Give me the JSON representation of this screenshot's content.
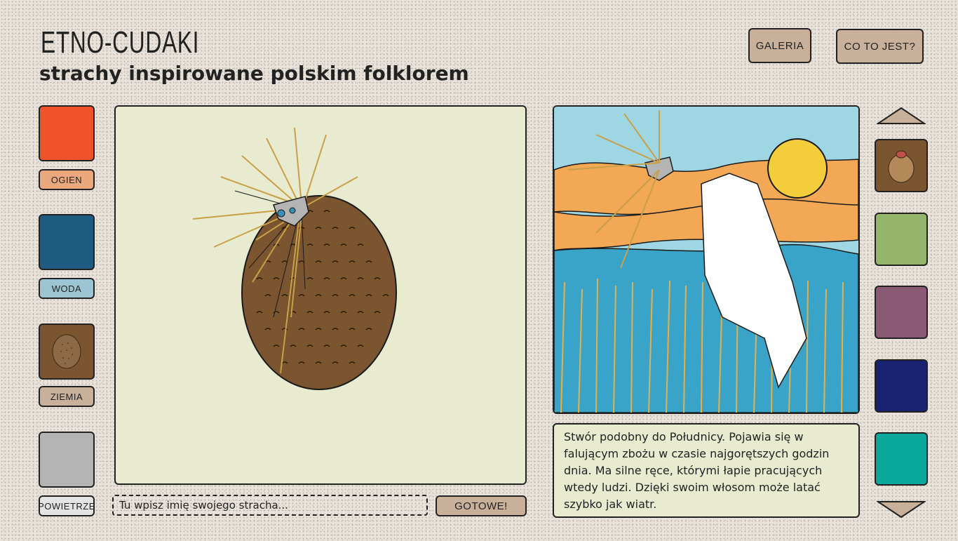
{
  "header": {
    "title": "ETNO-CUDAKI",
    "subtitle": "strachy inspirowane polskim folklorem"
  },
  "top_buttons": {
    "gallery": "GALERIA",
    "about": "CO TO JEST?"
  },
  "elements": [
    {
      "label": "OGIEN",
      "color": "#f0522a",
      "label_bg": "#eba87e"
    },
    {
      "label": "WODA",
      "color": "#1f5b80",
      "label_bg": "#9cc4d2"
    },
    {
      "label": "ZIEMIA",
      "color": "#7a5530",
      "label_bg": "#c8b09a"
    },
    {
      "label": "POWIETRZE",
      "color": "#b4b4b4",
      "label_bg": "#e4e4e4"
    }
  ],
  "name_input": {
    "placeholder": "Tu wpisz imię swojego stracha..."
  },
  "submit_label": "GOTOWE!",
  "description": "Stwór podobny do Południcy. Pojawia się w falującym zbożu w czasie najgorętszych godzin dnia. Ma silne ręce, którymi łapie pracujących wtedy ludzi. Dzięki swoim włosom może latać szybko jak wiatr.",
  "right_swatches": [
    {
      "name": "creature-thumb",
      "color": "#7a5530"
    },
    {
      "name": "green",
      "color": "#94b56a"
    },
    {
      "name": "purple",
      "color": "#8a5a74"
    },
    {
      "name": "navy",
      "color": "#182270"
    },
    {
      "name": "teal",
      "color": "#0aa99b"
    }
  ],
  "icons": {
    "up": "chevron-up-icon",
    "down": "chevron-down-icon"
  }
}
